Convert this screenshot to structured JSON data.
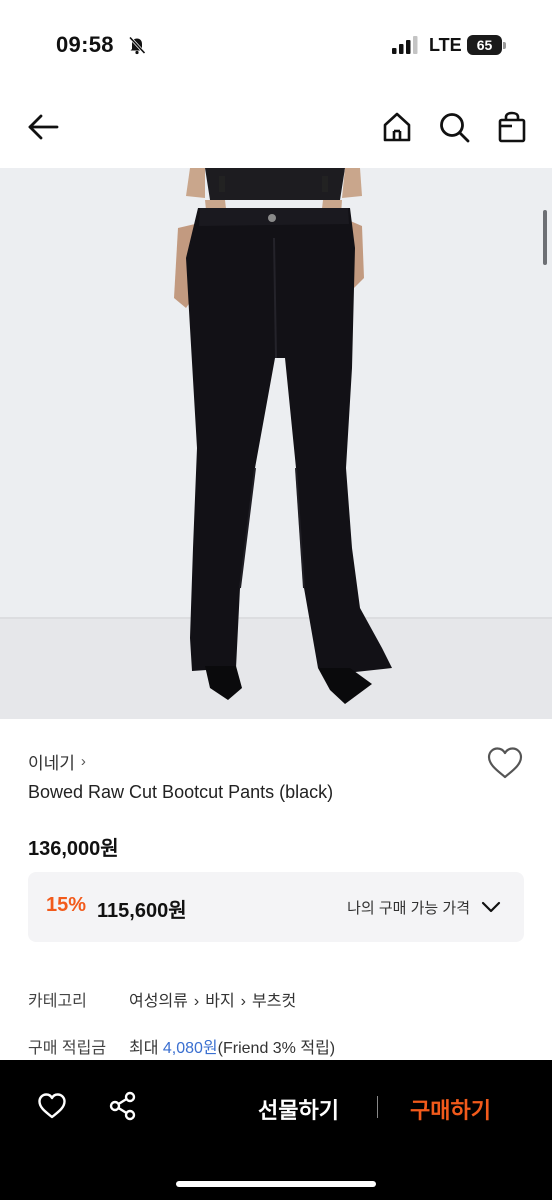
{
  "status_bar": {
    "time": "09:58",
    "network": "LTE",
    "battery": "65"
  },
  "nav": {
    "back_icon": "arrow-left-icon",
    "home_icon": "home-icon",
    "search_icon": "search-icon",
    "bag_icon": "shopping-bag-icon"
  },
  "product": {
    "brand": "이네기",
    "title": "Bowed Raw Cut Bootcut Pants (black)",
    "list_price": "136,000원",
    "discount_rate": "15%",
    "sale_price": "115,600원",
    "my_price_label": "나의 구매 가능 가격"
  },
  "info": {
    "category_label": "카테고리",
    "category_path": [
      "여성의류",
      "바지",
      "부츠컷"
    ],
    "points_label": "구매 적립금",
    "points_prefix": "최대 ",
    "points_amount": "4,080원",
    "points_suffix": "(Friend 3% 적립)"
  },
  "bottom_bar": {
    "gift_label": "선물하기",
    "buy_label": "구매하기"
  },
  "colors": {
    "accent": "#f25a1b",
    "link_blue": "#3a6fd0",
    "bar_bg": "#000000"
  }
}
